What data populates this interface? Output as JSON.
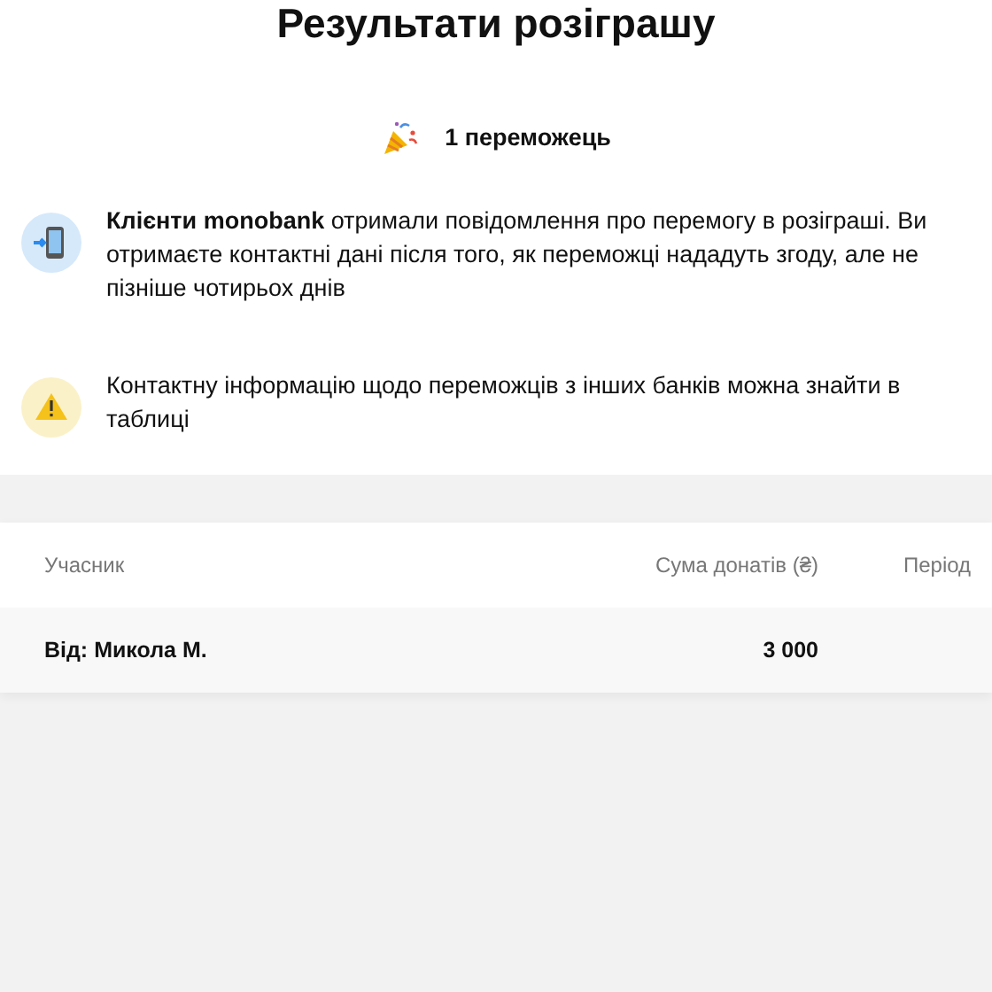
{
  "title": "Результати розіграшу",
  "winners": {
    "text": "1 переможець"
  },
  "notices": [
    {
      "kind": "phone",
      "text": "**Клієнти monobank** отримали повідомлення про перемогу в розіграші. Ви отримаєте контактні дані після того, як переможці нададуть згоду, але не пізніше чотирьох днів"
    },
    {
      "kind": "warning",
      "text": "Контактну інформацію щодо переможців з інших банків можна знайти в таблиці"
    }
  ],
  "table": {
    "columns": [
      "Учасник",
      "Сума донатів (₴)",
      "Період"
    ],
    "rows": [
      {
        "participant": "Від: Микола М.",
        "amount": "3 000"
      }
    ]
  }
}
